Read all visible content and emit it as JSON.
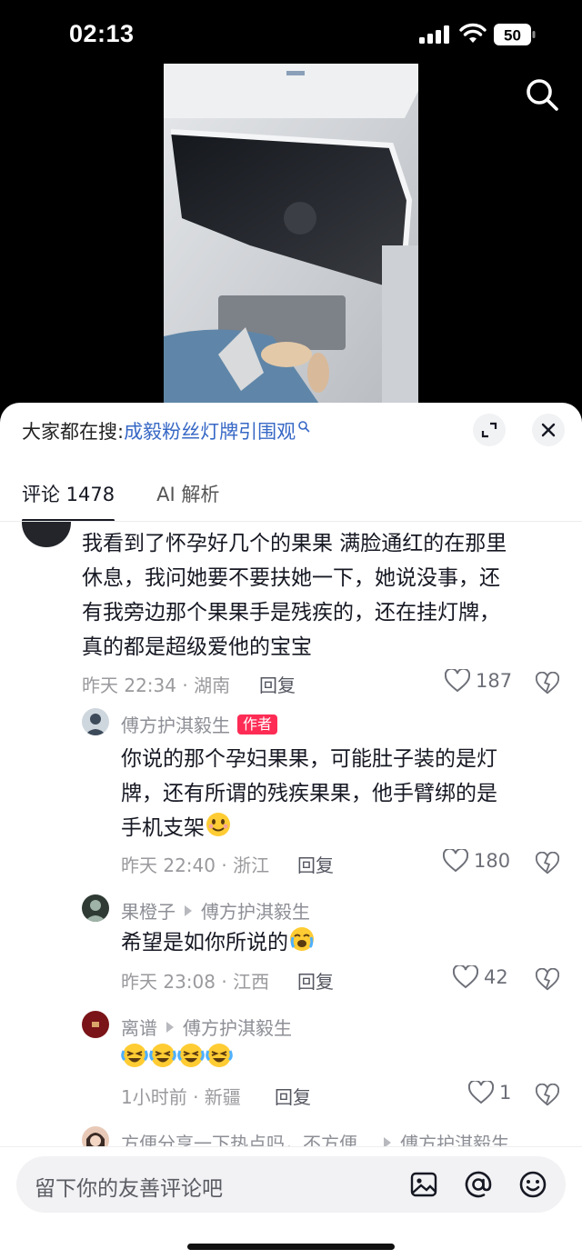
{
  "status": {
    "time": "02:13",
    "battery": "50"
  },
  "icons": {
    "signal": "cellular-signal-icon",
    "wifi": "wifi-icon",
    "battery": "battery-icon",
    "search": "search-icon",
    "expand": "expand-icon",
    "close": "close-icon",
    "heart": "heart-icon",
    "dislike": "broken-heart-icon",
    "image": "image-icon",
    "at": "at-icon",
    "emoji": "smiley-icon"
  },
  "sheet": {
    "search_prefix": "大家都在搜:",
    "search_keyword": "成毅粉丝灯牌引围观",
    "tabs": [
      {
        "label": "评论 1478"
      },
      {
        "label": "AI 解析"
      }
    ]
  },
  "comments": {
    "main": {
      "lines": [
        "我看到了怀孕好几个的果果 满脸通红的在那里",
        "休息，我问她要不要扶她一下，她说没事，还",
        "有我旁边那个果果手是残疾的，还在挂灯牌，",
        "真的都是超级爱他的宝宝"
      ],
      "meta": "昨天 22:34 · 湖南",
      "reply": "回复",
      "likes": "187"
    },
    "replies": [
      {
        "name": "傅方护淇毅生",
        "tag": "作者",
        "lines": [
          "你说的那个孕妇果果，可能肚子装的是灯",
          "牌，还有所谓的残疾果果，他手臂绑的是",
          "手机支架"
        ],
        "meta": "昨天 22:40 · 浙江",
        "reply": "回复",
        "likes": "180"
      },
      {
        "name": "果橙子",
        "to": "傅方护淇毅生",
        "lines": [
          "希望是如你所说的"
        ],
        "meta": "昨天 23:08 · 江西",
        "reply": "回复",
        "likes": "42"
      },
      {
        "name": "离谱",
        "to": "傅方护淇毅生",
        "lines": [
          ""
        ],
        "meta": "1小时前 · 新疆",
        "reply": "回复",
        "likes": "1"
      },
      {
        "name": "方便分享一下热点吗，不方便...",
        "to": "傅方护淇毅生"
      }
    ]
  },
  "input": {
    "placeholder": "留下你的友善评论吧"
  },
  "colors": {
    "accent": "#fe2c55",
    "link": "#3768c6"
  }
}
